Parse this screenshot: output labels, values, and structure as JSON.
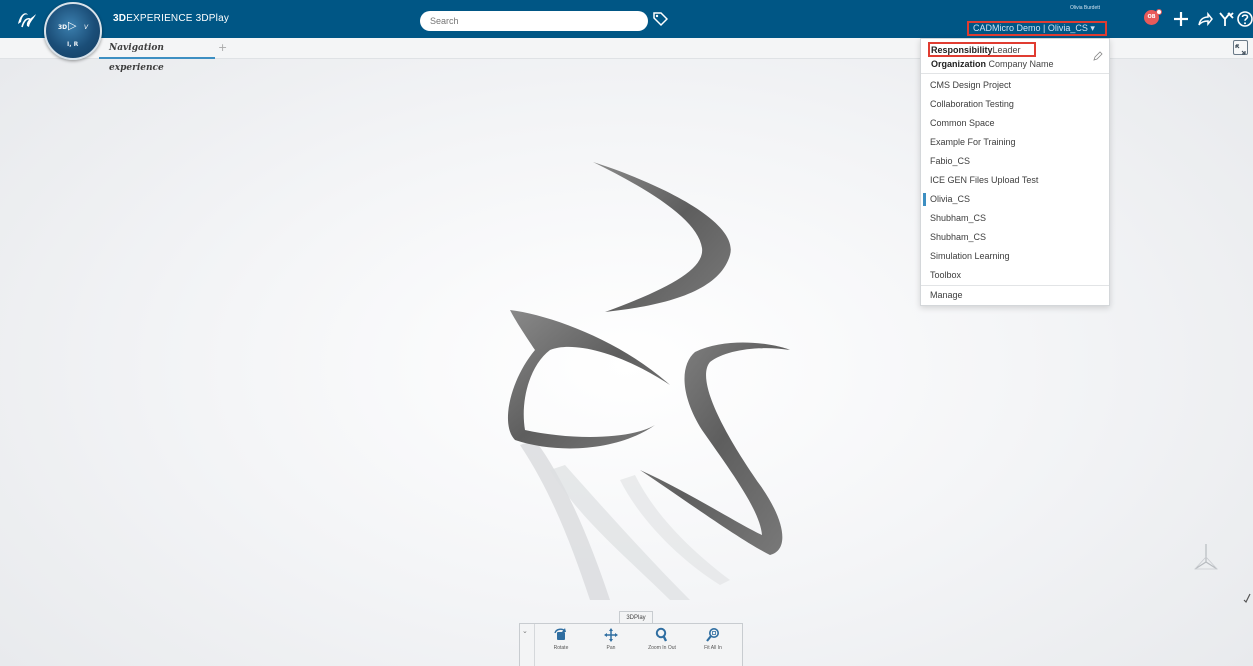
{
  "app": {
    "brand_bold": "3D",
    "brand_rest": "EXPERIENCE 3DPlay",
    "compass": {
      "label_3d": "3D",
      "label_v": "V",
      "label_iu": "I, R"
    }
  },
  "search": {
    "placeholder": "Search"
  },
  "user": {
    "name": "Olivia Burdett",
    "collab_space": "CADMicro Demo | Olivia_CS",
    "initials": "OB"
  },
  "tabs": [
    {
      "label": "Navigation experience"
    }
  ],
  "tab_add": "+",
  "dropdown": {
    "responsibility_key": "Responsibility",
    "responsibility_value": "Leader",
    "organization_key": "Organization",
    "organization_value": "Company Name",
    "items": [
      {
        "label": "CMS Design Project"
      },
      {
        "label": "Collaboration Testing"
      },
      {
        "label": "Common Space"
      },
      {
        "label": "Example For Training"
      },
      {
        "label": "Fabio_CS"
      },
      {
        "label": "ICE GEN Files Upload Test"
      },
      {
        "label": "Olivia_CS",
        "active": true
      },
      {
        "label": "Shubham_CS"
      },
      {
        "label": "Shubham_CS"
      },
      {
        "label": "Simulation Learning"
      },
      {
        "label": "Toolbox"
      }
    ],
    "manage": "Manage"
  },
  "action_bar": {
    "tab_label": "3DPlay",
    "buttons": [
      {
        "label": "Rotate",
        "icon": "rotate-icon"
      },
      {
        "label": "Pan",
        "icon": "pan-icon"
      },
      {
        "label": "Zoom In Out",
        "icon": "zoom-icon"
      },
      {
        "label": "Fit All In",
        "icon": "fit-all-icon"
      }
    ]
  },
  "colors": {
    "topbar": "#005685",
    "highlight_border": "#e03c31",
    "accent": "#3d8fc2",
    "model": "#6b6b6b"
  }
}
